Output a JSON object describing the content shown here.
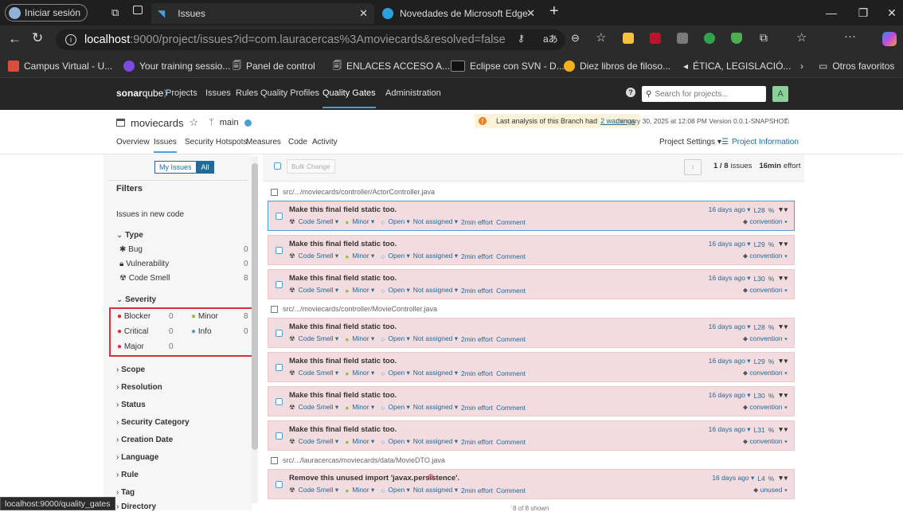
{
  "browser": {
    "signin_label": "Iniciar sesión",
    "tabs": [
      {
        "title": "Issues",
        "active": true
      },
      {
        "title": "Novedades de Microsoft Edge",
        "active": false
      }
    ],
    "new_tab_symbol": "+",
    "url_host": "localhost",
    "url_rest": ":9000/project/issues?id=com.lauracercas%3Amoviecards&resolved=false",
    "bookmarks": [
      "Campus Virtual - U...",
      "Your training sessio...",
      "Panel de control",
      "ENLACES ACCESO A...",
      "Eclipse con SVN - D...",
      "Diez libros de filoso...",
      "ÉTICA, LEGISLACIÓ..."
    ],
    "other_favorites": "Otros favoritos",
    "status_url": "localhost:9000/quality_gates"
  },
  "sonar": {
    "logo_bold": "sonar",
    "logo_rest": "qube",
    "nav": [
      "Projects",
      "Issues",
      "Rules",
      "Quality Profiles",
      "Quality Gates",
      "Administration"
    ],
    "active_nav": "Quality Gates",
    "search_placeholder": "Search for projects...",
    "avatar_letter": "A"
  },
  "project": {
    "name": "moviecards",
    "branch": "main",
    "warning_prefix": "Last analysis of this Branch had",
    "warning_link": "2 warnings",
    "analysis_info": "January 30, 2025 at 12:08 PM  Version 0.0.1-SNAPSHOT",
    "tabs": [
      "Overview",
      "Issues",
      "Security Hotspots",
      "Measures",
      "Code",
      "Activity"
    ],
    "active_tab": "Issues",
    "settings_label": "Project Settings ▾",
    "info_label": "Project Information"
  },
  "filters": {
    "my_issues": "My Issues",
    "all": "All",
    "title": "Filters",
    "new_code": "Issues in new code",
    "type_header": "Type",
    "types": [
      {
        "label": "Bug",
        "count": "0",
        "icon": "bug-icon"
      },
      {
        "label": "Vulnerability",
        "count": "0",
        "icon": "lock-icon"
      },
      {
        "label": "Code Smell",
        "count": "8",
        "icon": "code-smell-icon"
      }
    ],
    "severity_header": "Severity",
    "severities": [
      {
        "label": "Blocker",
        "count": "0",
        "color": "#d02f3a"
      },
      {
        "label": "Minor",
        "count": "8",
        "color": "#8cc33f"
      },
      {
        "label": "Critical",
        "count": "0",
        "color": "#d4333f"
      },
      {
        "label": "Info",
        "count": "0",
        "color": "#4b9fd5"
      },
      {
        "label": "Major",
        "count": "0",
        "color": "#d4333f"
      }
    ],
    "collapsed": [
      "Scope",
      "Resolution",
      "Status",
      "Security Category",
      "Creation Date",
      "Language",
      "Rule",
      "Tag",
      "Directory"
    ]
  },
  "issues_panel": {
    "bulk_change": "Bulk Change",
    "count_text": "1 / 8",
    "issues_word": "issues",
    "effort": "16min",
    "effort_word": "effort",
    "footer": "8 of 8 shown",
    "files": [
      {
        "path": "src/.../moviecards/controller/ActorController.java",
        "issues": [
          {
            "message": "Make this final field static too.",
            "line": "L28",
            "tag": "convention",
            "selected": true
          },
          {
            "message": "Make this final field static too.",
            "line": "L29",
            "tag": "convention"
          },
          {
            "message": "Make this final field static too.",
            "line": "L30",
            "tag": "convention"
          }
        ]
      },
      {
        "path": "src/.../moviecards/controller/MovieController.java",
        "issues": [
          {
            "message": "Make this final field static too.",
            "line": "L28",
            "tag": "convention"
          },
          {
            "message": "Make this final field static too.",
            "line": "L29",
            "tag": "convention"
          },
          {
            "message": "Make this final field static too.",
            "line": "L30",
            "tag": "convention"
          },
          {
            "message": "Make this final field static too.",
            "line": "L31",
            "tag": "convention"
          }
        ]
      },
      {
        "path": "src/.../lauracercas/moviecards/data/MovieDTO.java",
        "issues": [
          {
            "message": "Remove this unused import 'javax.persistence'.",
            "line": "L4",
            "tag": "unused"
          }
        ]
      }
    ],
    "meta": {
      "type": "Code Smell ▾",
      "severity": "Minor ▾",
      "status": "Open ▾",
      "assignee": "Not assigned ▾",
      "effort": "2min effort",
      "comment": "Comment",
      "age": "16 days ago ▾"
    }
  },
  "colors": {
    "highlight_box": "#d9303b",
    "accent": "#236a97",
    "issue_bg": "#f3dcdf"
  }
}
